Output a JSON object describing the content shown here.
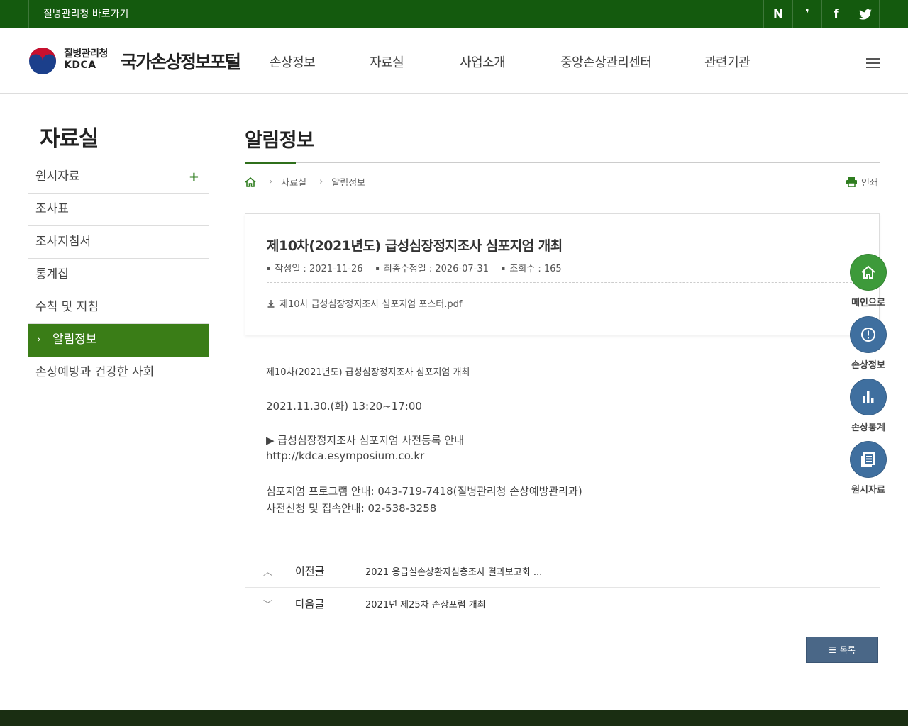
{
  "topbar": {
    "kdca_link": "질병관리청 바로가기",
    "sns": [
      {
        "icon": "naver-blog-icon",
        "glyph": "N"
      },
      {
        "icon": "naver-post-icon",
        "glyph": "❜"
      },
      {
        "icon": "facebook-icon",
        "glyph": "f"
      },
      {
        "icon": "twitter-icon",
        "glyph": "🐦"
      }
    ],
    "color": "#145a0e"
  },
  "header": {
    "org_name": "질병관리청",
    "org_en": "KDCA",
    "portal_title": "국가손상정보포털",
    "gnb": [
      "손상정보",
      "자료실",
      "사업소개",
      "중앙손상관리센터",
      "관련기관"
    ]
  },
  "sidebar": {
    "title": "자료실",
    "items": [
      {
        "label": "원시자료",
        "has_children": true
      },
      {
        "label": "조사표"
      },
      {
        "label": "조사지침서"
      },
      {
        "label": "통계집"
      },
      {
        "label": "수칙 및 지침"
      },
      {
        "label": "알림정보",
        "active": true
      },
      {
        "label": "손상예방과 건강한 사회"
      }
    ],
    "active_color": "#3a7d17"
  },
  "content": {
    "page_title": "알림정보",
    "breadcrumb": [
      "자료실",
      "알림정보"
    ],
    "print_label": "인쇄",
    "post": {
      "title": "제10차(2021년도) 급성심장정지조사 심포지엄 개최",
      "meta": {
        "created": "작성일 : 2021-11-26",
        "modified": "최종수정일 : 2026-07-31",
        "views": "조회수 : 165"
      },
      "attachment": "제10차 급성심장정지조사 심포지엄 포스터.pdf"
    },
    "body": {
      "line1": "제10차(2021년도) 급성심장정지조사 심포지엄 개최",
      "line2": "2021.11.30.(화) 13:20~17:00",
      "line3": "▶ 급성심장정지조사 심포지엄 사전등록 안내",
      "line4": "http://kdca.esymposium.co.kr",
      "line5": "심포지엄 프로그램 안내: 043-719-7418(질병관리청 손상예방관리과)",
      "line6": "사전신청 및 접속안내: 02-538-3258"
    },
    "nav": {
      "prev_label": "이전글",
      "prev_title": "2021 응급실손상환자심층조사 결과보고회 ...",
      "next_label": "다음글",
      "next_title": "2021년 제25차 손상포럼 개최"
    },
    "list_button": "목록"
  },
  "quick_menu": [
    {
      "label": "메인으로",
      "icon": "home-icon",
      "color": "#3d9a3a"
    },
    {
      "label": "손상정보",
      "icon": "alert-icon",
      "color": "#3f6f9f"
    },
    {
      "label": "손상통계",
      "icon": "bar-chart-icon",
      "color": "#3f6f9f"
    },
    {
      "label": "원시자료",
      "icon": "document-icon",
      "color": "#3f6f9f"
    }
  ]
}
